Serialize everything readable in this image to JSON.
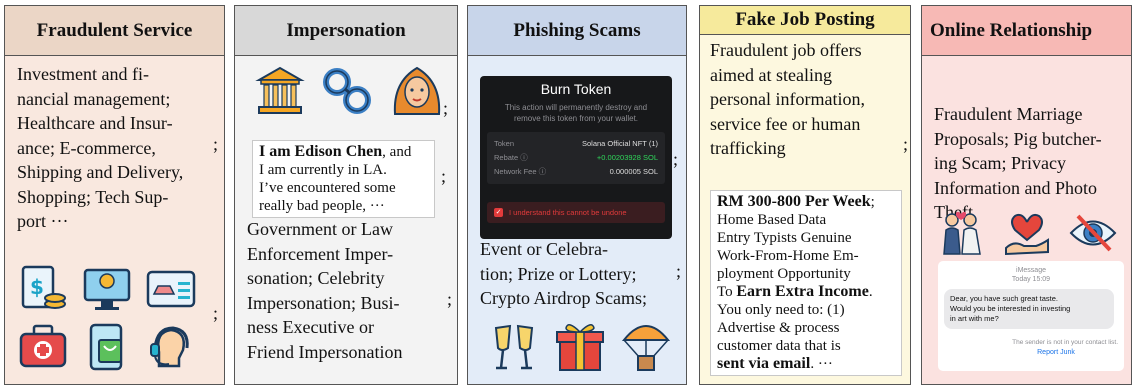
{
  "colors": {
    "fraud_bg": "#f9e8df",
    "fraud_hdr": "#ebd6c6",
    "imp_bg": "#f3f3f3",
    "imp_hdr": "#d8d8d8",
    "phish_bg": "#e3ecf8",
    "phish_hdr": "#c8d5ea",
    "job_bg": "#fdf8df",
    "job_hdr": "#f6ea9c",
    "online_bg": "#fbe2e0",
    "online_hdr": "#f7b9b5",
    "sol_green": "#2fd65a",
    "checkbox_red": "#e23b3b",
    "report_blue": "#1a73e8"
  },
  "separator": ";",
  "panels": {
    "fraudulent_service": {
      "title": "Fraudulent Service",
      "lines": [
        "Investment and fi-",
        "nancial management;",
        "Healthcare and Insur-",
        "ance; E-commerce,",
        "Shipping and Delivery,",
        "Shopping; Tech Sup-",
        "port ···"
      ],
      "icons": [
        "invoice-coins-icon",
        "computer-dollar-icon",
        "car-id-card-icon",
        "first-aid-kit-icon",
        "mobile-shopping-icon",
        "headset-support-icon"
      ]
    },
    "impersonation": {
      "title": "Impersonation",
      "icons": [
        "government-building-icon",
        "handcuffs-icon",
        "celebrity-icon"
      ],
      "quote": {
        "bold": "I am Edison Chen",
        "lines": [
          ", and",
          "I am currently in LA.",
          "I’ve encountered some",
          "really bad people, ···"
        ]
      },
      "lines": [
        "Government or Law",
        "Enforcement Imper-",
        "sonation; Celebrity",
        "Impersonation; Busi-",
        "ness Executive or",
        "Friend Impersonation"
      ]
    },
    "phishing_scams": {
      "title": "Phishing Scams",
      "screen": {
        "title": "Burn Token",
        "desc_lines": [
          "This action will permanently destroy and",
          "remove this token from your wallet."
        ],
        "rows": [
          {
            "label": "Token",
            "value": "Solana Official NFT (1)"
          },
          {
            "label": "Rebate ⓘ",
            "value": "+0.00203928 SOL"
          },
          {
            "label": "Network Fee ⓘ",
            "value": "0.000005 SOL"
          }
        ],
        "checkbox_label": "I understand this cannot be undone"
      },
      "lines": [
        "Event or Celebra-",
        "tion; Prize or Lottery;",
        "Crypto Airdrop Scams;"
      ],
      "icons": [
        "champagne-toast-icon",
        "gift-box-icon",
        "parachute-airdrop-icon"
      ]
    },
    "fake_job_posting": {
      "title": "Fake Job Posting",
      "lines": [
        "Fraudulent job offers",
        "aimed at stealing",
        "personal information,",
        "service fee or human",
        "trafficking"
      ],
      "ad": {
        "headline_bold": "RM 300-800 Per Week",
        "headline_rest": ";",
        "lines": [
          "Home Based Data",
          "Entry Typists Genuine",
          "Work-From-Home Em-",
          "ployment Opportunity"
        ],
        "to_text": "To ",
        "earn_bold": "Earn Extra Income",
        "earn_rest": ".",
        "lines2": [
          "You only need to: (1)",
          "Advertise & process",
          "customer data that is"
        ],
        "email_bold": "sent via email",
        "email_rest": ". ···"
      }
    },
    "online_relationship": {
      "title": "Online Relationship",
      "lines": [
        "Fraudulent Marriage",
        "Proposals; Pig butcher-",
        "ing Scam; Privacy",
        "Information and Photo",
        "Theft"
      ],
      "icons": [
        "couple-icon",
        "heart-hand-icon",
        "eye-slash-icon"
      ],
      "chat": {
        "app": "iMessage",
        "time": "Today 15:09",
        "message_lines": [
          "Dear, you have such great taste.",
          "Would you be interested in investing",
          "in art with me?"
        ],
        "notice": "The sender is not in your contact list.",
        "report": "Report Junk"
      }
    }
  }
}
